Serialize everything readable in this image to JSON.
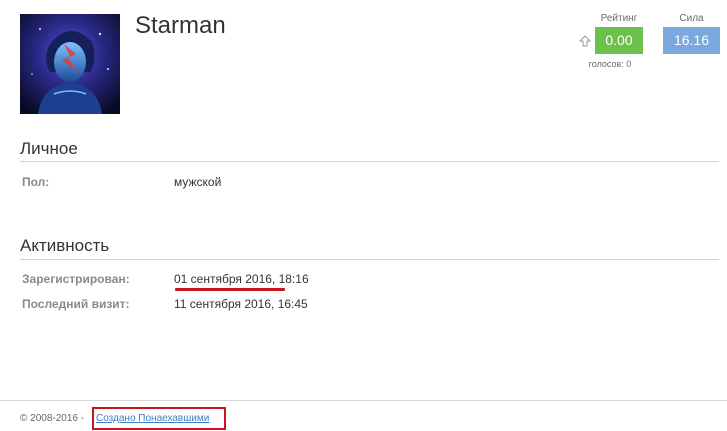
{
  "profile": {
    "username": "Starman",
    "avatar_icon": "starman-avatar-image"
  },
  "rating": {
    "title": "Рейтинг",
    "value": "0.00",
    "votes": "голосов: 0",
    "color": "#6cc14a"
  },
  "strength": {
    "title": "Сила",
    "value": "16.16",
    "color": "#7aa7dc"
  },
  "personal": {
    "title": "Личное",
    "rows": [
      {
        "label": "Пол:",
        "value": "мужской"
      }
    ]
  },
  "activity": {
    "title": "Активность",
    "rows": [
      {
        "label": "Зарегистрирован:",
        "value": "01 сентября 2016, 18:16"
      },
      {
        "label": "Последний визит:",
        "value": "11 сентября 2016, 16:45"
      }
    ]
  },
  "footer": {
    "copyright": "© 2008-2016 -",
    "link": "Создано Понаехавшими",
    "highlight_color": "#c8141c"
  }
}
